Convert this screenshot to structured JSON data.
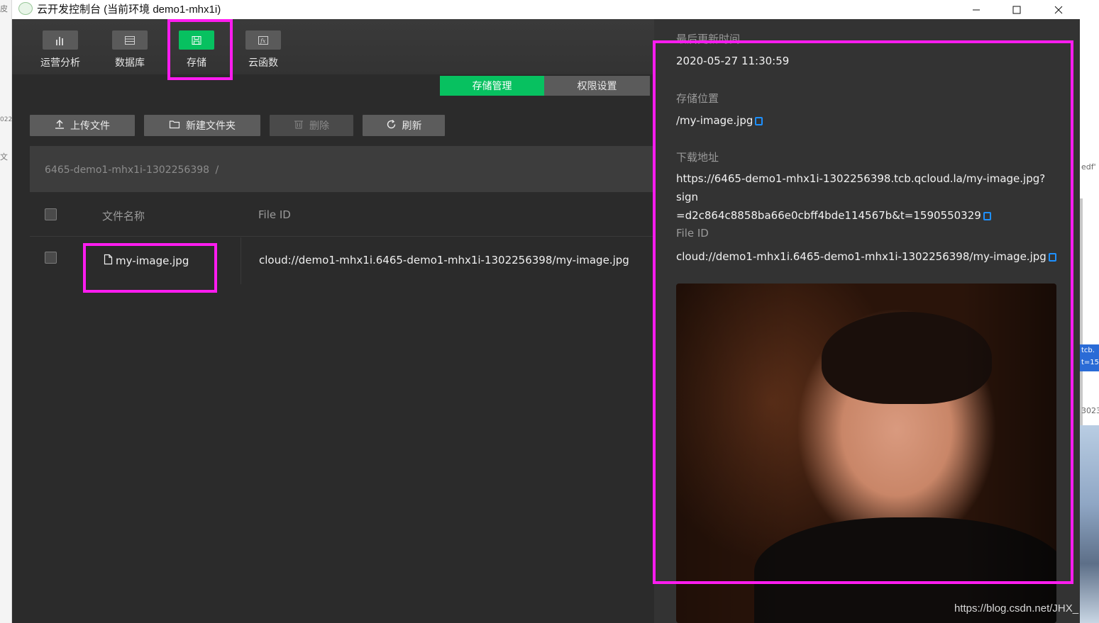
{
  "window": {
    "title": "云开发控制台 (当前环境 demo1-mhx1i)",
    "controls": [
      "minimize-icon",
      "maximize-icon",
      "close-icon"
    ]
  },
  "toolbar": {
    "items": [
      {
        "label": "运营分析",
        "icon": "chart-icon"
      },
      {
        "label": "数据库",
        "icon": "database-icon"
      },
      {
        "label": "存储",
        "icon": "storage-icon",
        "active": true
      },
      {
        "label": "云函数",
        "icon": "function-icon"
      }
    ]
  },
  "tabs": {
    "storage_manage": "存储管理",
    "permission_settings": "权限设置"
  },
  "actions": {
    "upload": "上传文件",
    "new_folder": "新建文件夹",
    "delete": "删除",
    "refresh": "刷新"
  },
  "breadcrumb": {
    "path": "6465-demo1-mhx1i-1302256398",
    "separator": "/"
  },
  "table": {
    "columns": [
      "文件名称",
      "File ID"
    ],
    "rows": [
      {
        "name": "my-image.jpg",
        "file_id": "cloud://demo1-mhx1i.6465-demo1-mhx1i-1302256398/my-image.jpg"
      }
    ]
  },
  "detail": {
    "last_update_label": "最后更新时间",
    "last_update_value": "2020-05-27 11:30:59",
    "location_label": "存储位置",
    "location_value": "/my-image.jpg",
    "download_label": "下载地址",
    "download_line1": "https://6465-demo1-mhx1i-1302256398.tcb.qcloud.la/my-image.jpg?sign",
    "download_line2": "=d2c864c8858ba66e0cbff4bde114567b&t=1590550329",
    "fileid_label": "File ID",
    "fileid_value": "cloud://demo1-mhx1i.6465-demo1-mhx1i-1302256398/my-image.jpg"
  },
  "colors": {
    "accent": "#07c160",
    "highlight": "#ff1cf0",
    "copy_icon": "#1e90ff"
  },
  "background": {
    "left_fragments": [
      "皮",
      "022",
      "文"
    ],
    "right_fragments": [
      "edf'",
      "tcb.",
      "t=15",
      "3023"
    ]
  },
  "watermark": "https://blog.csdn.net/JHX_"
}
